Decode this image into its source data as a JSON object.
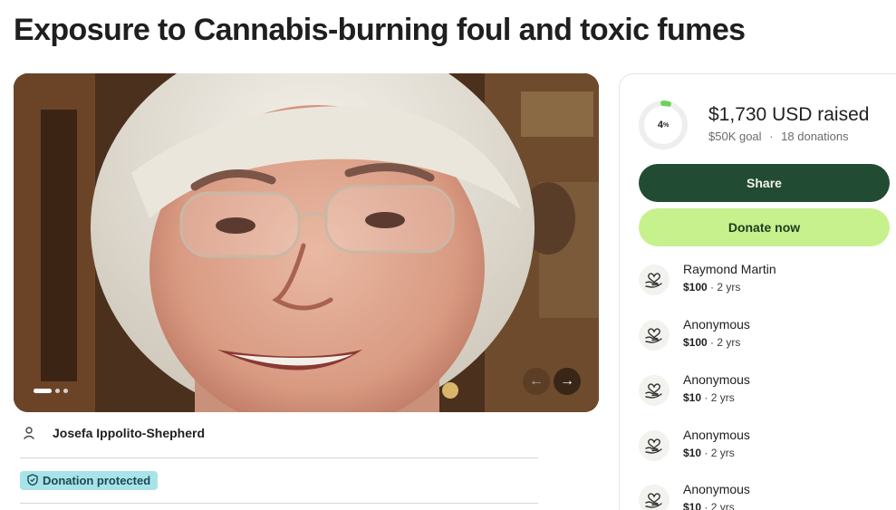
{
  "page": {
    "title": "Exposure to Cannabis-burning foul and toxic fumes"
  },
  "carousel": {
    "slides": 3,
    "active_index": 0,
    "prev_icon": "arrow-left-icon",
    "next_icon": "arrow-right-icon"
  },
  "organizer": {
    "name": "Josefa Ippolito-Shepherd",
    "icon": "user-icon"
  },
  "badge": {
    "label": "Donation protected",
    "icon": "shield-icon"
  },
  "progress": {
    "percent_number": "4",
    "percent_sign": "%",
    "percent_value": 0.04,
    "raised": "$1,730 USD raised",
    "goal": "$50K goal",
    "separator": "·",
    "donations": "18 donations"
  },
  "actions": {
    "share_label": "Share",
    "donate_label": "Donate now"
  },
  "donors": [
    {
      "name": "Raymond Martin",
      "amount": "$100",
      "time": " · 2 yrs",
      "icon": "heart-hand-icon"
    },
    {
      "name": "Anonymous",
      "amount": "$100",
      "time": " · 2 yrs",
      "icon": "heart-hand-icon"
    },
    {
      "name": "Anonymous",
      "amount": "$10",
      "time": " · 2 yrs",
      "icon": "heart-hand-icon"
    },
    {
      "name": "Anonymous",
      "amount": "$10",
      "time": " · 2 yrs",
      "icon": "heart-hand-icon"
    },
    {
      "name": "Anonymous",
      "amount": "$10",
      "time": " · 2 yrs",
      "icon": "heart-hand-icon"
    }
  ],
  "colors": {
    "share_bg": "#224b33",
    "donate_bg": "#c7f18c",
    "progress_accent": "#6bd35b",
    "badge_bg": "#a9e3ea"
  }
}
